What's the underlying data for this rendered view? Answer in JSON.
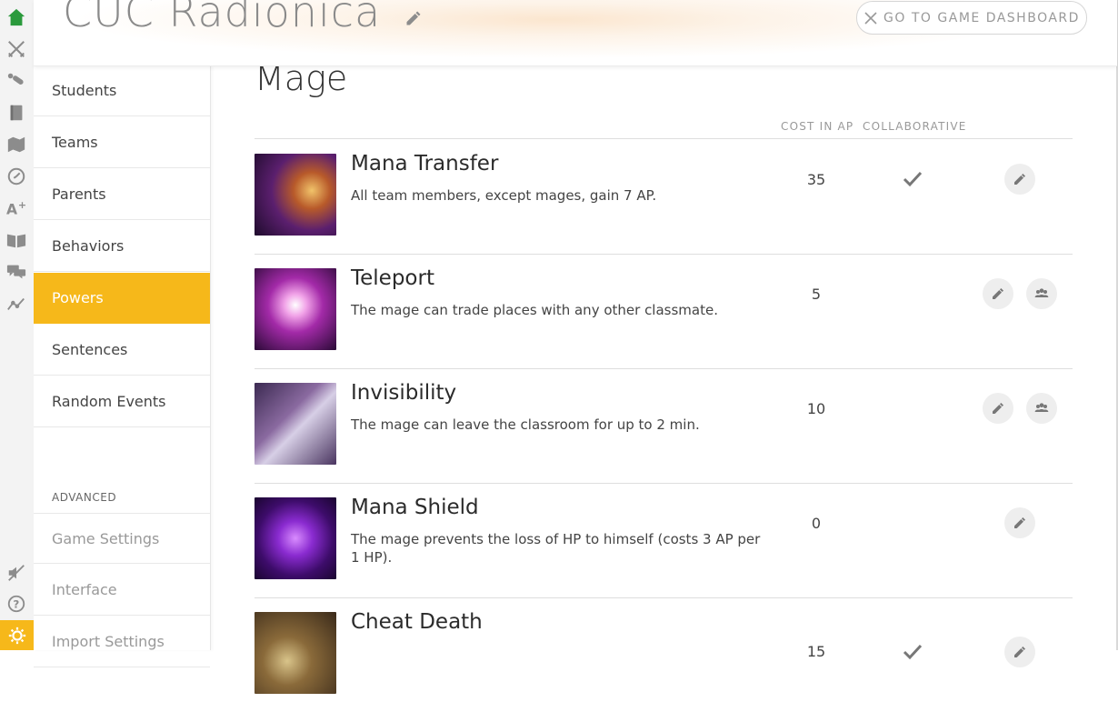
{
  "header": {
    "title": "CUC Radionica",
    "dashboard_button": "GO TO GAME DASHBOARD"
  },
  "sidebar": {
    "items": [
      {
        "label": "Students"
      },
      {
        "label": "Teams"
      },
      {
        "label": "Parents"
      },
      {
        "label": "Behaviors"
      },
      {
        "label": "Powers",
        "active": true
      },
      {
        "label": "Sentences"
      },
      {
        "label": "Random Events"
      }
    ],
    "advanced_heading": "ADVANCED",
    "advanced_items": [
      {
        "label": "Game Settings"
      },
      {
        "label": "Interface"
      },
      {
        "label": "Import Settings"
      }
    ]
  },
  "icons": {
    "rail": [
      "home-icon",
      "swords-icon",
      "potion-icon",
      "book-icon",
      "map-icon",
      "clock-icon",
      "grades-icon",
      "open-book-icon",
      "chat-icon",
      "chart-icon",
      "no-sound-icon",
      "help-icon",
      "gear-icon"
    ]
  },
  "colors": {
    "accent": "#f6b81a",
    "home_icon": "#2a9a3c"
  },
  "main": {
    "section_title": "Mage",
    "columns": {
      "cost": "COST IN AP",
      "collaborative": "COLLABORATIVE"
    },
    "powers": [
      {
        "name": "Mana Transfer",
        "description": "All team members, except mages, gain 7 AP.",
        "cost": "35",
        "collaborative": true
      },
      {
        "name": "Teleport",
        "description": "The mage can trade places with any other classmate.",
        "cost": "5",
        "collaborative": false
      },
      {
        "name": "Invisibility",
        "description": "The mage can leave the classroom for up to 2 min.",
        "cost": "10",
        "collaborative": false
      },
      {
        "name": "Mana Shield",
        "description": "The mage prevents the loss of HP to himself (costs 3 AP per 1 HP).",
        "cost": "0",
        "collaborative": false
      },
      {
        "name": "Cheat Death",
        "description": "",
        "cost": "15",
        "collaborative": true
      }
    ]
  }
}
